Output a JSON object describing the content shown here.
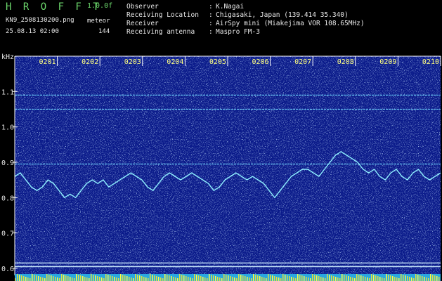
{
  "header": {
    "brand": "H R O F F T",
    "version": "1.0.0f",
    "filename": "KN9_2508130200.png",
    "meteor_label": "meteor",
    "datetime": "25.08.13 02:00",
    "count": "144",
    "info": [
      {
        "key": "Observer",
        "sep": ":",
        "value": "K.Nagai"
      },
      {
        "key": "Receiving Location",
        "sep": ":",
        "value": "Chigasaki, Japan (139.414 35.340)"
      },
      {
        "key": "Receiver",
        "sep": ":",
        "value": "AirSpy mini (Miakejima VOR 108.65MHz)"
      },
      {
        "key": "Receiving antenna",
        "sep": ":",
        "value": "Maspro FM-3"
      }
    ]
  },
  "chart_data": {
    "type": "heatmap",
    "ylabel": "kHz",
    "ylim": [
      0.58,
      1.2
    ],
    "yticks": [
      "1.1",
      "1.0",
      "0.9",
      "0.8",
      "0.7",
      "0.6"
    ],
    "yvalues": [
      1.1,
      1.0,
      0.9,
      0.8,
      0.7,
      0.6
    ],
    "time_labels": [
      "0201",
      "0202",
      "0203",
      "0204",
      "0205",
      "0206",
      "0207",
      "0208",
      "0209",
      "0210"
    ],
    "horizontal_lines_khz": [
      1.09,
      1.05,
      0.895,
      0.615,
      0.605
    ],
    "trace_khz": [
      0.86,
      0.87,
      0.85,
      0.83,
      0.82,
      0.83,
      0.85,
      0.84,
      0.82,
      0.8,
      0.81,
      0.8,
      0.82,
      0.84,
      0.85,
      0.84,
      0.85,
      0.83,
      0.84,
      0.85,
      0.86,
      0.87,
      0.86,
      0.85,
      0.83,
      0.82,
      0.84,
      0.86,
      0.87,
      0.86,
      0.85,
      0.86,
      0.87,
      0.86,
      0.85,
      0.84,
      0.82,
      0.83,
      0.85,
      0.86,
      0.87,
      0.86,
      0.85,
      0.86,
      0.85,
      0.84,
      0.82,
      0.8,
      0.82,
      0.84,
      0.86,
      0.87,
      0.88,
      0.88,
      0.87,
      0.86,
      0.88,
      0.9,
      0.92,
      0.93,
      0.92,
      0.91,
      0.9,
      0.88,
      0.87,
      0.88,
      0.86,
      0.85,
      0.87,
      0.88,
      0.86,
      0.85,
      0.87,
      0.88,
      0.86,
      0.85,
      0.86,
      0.87
    ]
  }
}
